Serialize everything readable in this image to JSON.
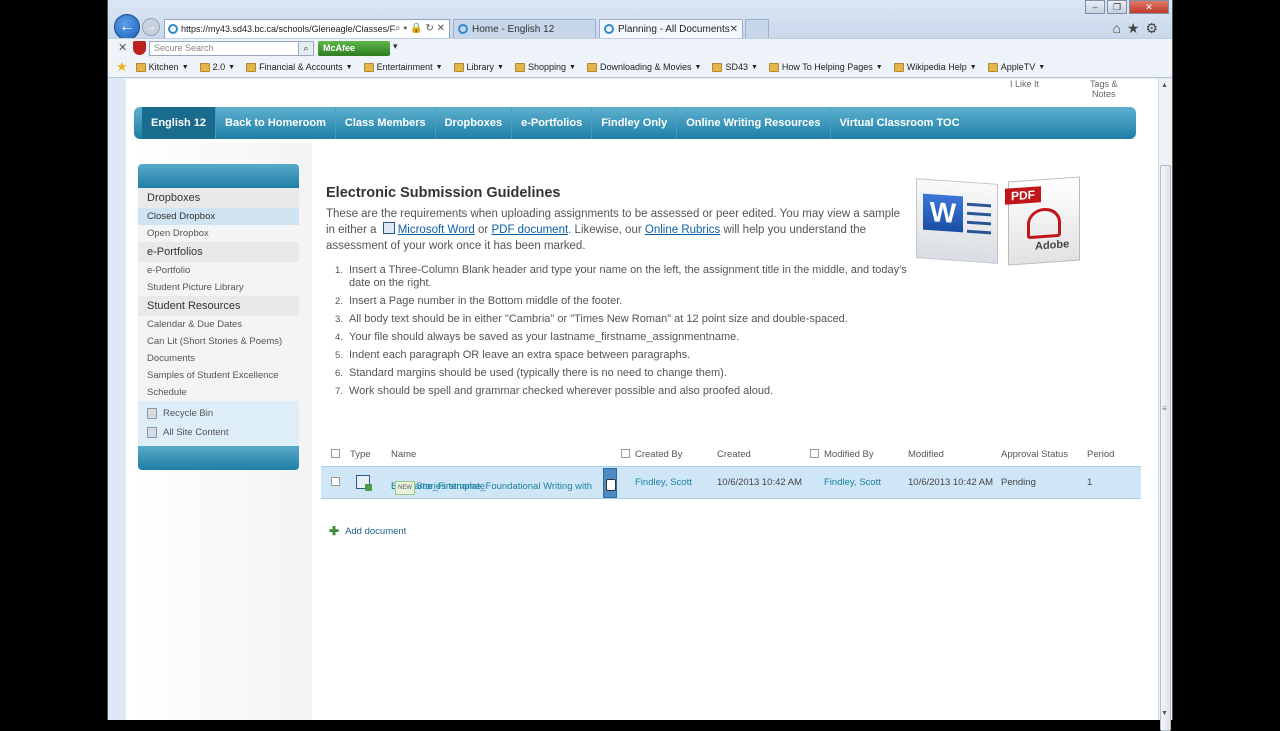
{
  "browser": {
    "address_url": "https://my43.sd43.bc.ca/schools/Gleneagle/Classes/F",
    "tabs": [
      {
        "label": "Home - English 12"
      },
      {
        "label": "Planning - All Documents"
      }
    ],
    "search_placeholder": "Secure Search",
    "mcafee_label": "McAfee"
  },
  "favorites": [
    {
      "label": "Kitchen"
    },
    {
      "label": "2.0"
    },
    {
      "label": "Financial & Accounts"
    },
    {
      "label": "Entertainment"
    },
    {
      "label": "Library"
    },
    {
      "label": "Shopping"
    },
    {
      "label": "Downloading & Movies"
    },
    {
      "label": "SD43"
    },
    {
      "label": "How To Helping Pages"
    },
    {
      "label": "Wikipedia Help"
    },
    {
      "label": "AppleTV"
    }
  ],
  "top_links": {
    "i_like_it": "I Like It",
    "tags_line1": "Tags &",
    "tags_line2": "Notes"
  },
  "topnav": [
    {
      "label": "English 12"
    },
    {
      "label": "Back to Homeroom"
    },
    {
      "label": "Class Members"
    },
    {
      "label": "Dropboxes"
    },
    {
      "label": "e-Portfolios"
    },
    {
      "label": "Findley Only"
    },
    {
      "label": "Online Writing Resources"
    },
    {
      "label": "Virtual Classroom TOC"
    }
  ],
  "sidenav": {
    "sections": [
      {
        "title": "Dropboxes",
        "items": [
          "Closed Dropbox",
          "Open Dropbox"
        ]
      },
      {
        "title": "e-Portfolios",
        "items": [
          "e-Portfolio",
          "Student Picture Library"
        ]
      },
      {
        "title": "Student Resources",
        "items": [
          "Calendar & Due Dates",
          "Can Lit (Short Stories & Poems)",
          "Documents",
          "Samples of Student Excellence",
          "Schedule"
        ]
      }
    ],
    "recycle_bin": "Recycle Bin",
    "all_site_content": "All Site Content"
  },
  "main": {
    "heading": "Electronic Submission Guidelines",
    "intro_part1": "These are the requirements when uploading assignments to be assessed or peer edited. You may view a sample in either a",
    "link_word": "Microsoft Word",
    "or_text": "or",
    "link_pdf": "PDF document",
    "likewise_text": ". Likewise, our",
    "link_rubrics": "Online Rubrics",
    "intro_part2": "will help you understand the assessment of your work once it has been marked.",
    "requirements": [
      "Insert a Three-Column Blank header and type your name on the left, the assignment title in the middle, and today's date on the right.",
      "Insert a Page number in the Bottom middle of the footer.",
      "All body text should be in either \"Cambria\" or \"Times New Roman\" at 12 point size and double-spaced.",
      "Your file should always be saved as your lastname_firstname_assignmentname.",
      "Indent each paragraph OR leave an extra space between paragraphs.",
      "Standard margins should be used (typically there is no need to change them).",
      "Work should be spell and grammar checked wherever possible and also proofed aloud."
    ],
    "logos": {
      "word_letter": "W",
      "pdf_tag": "PDF",
      "adobe_label": "Adobe"
    }
  },
  "list": {
    "columns": {
      "type": "Type",
      "name": "Name",
      "created_by": "Created By",
      "created": "Created",
      "modified_by": "Modified By",
      "modified": "Modified",
      "approval": "Approval Status",
      "period": "Period"
    },
    "rows": [
      {
        "name_line1": "Lastname_Firstname_Foundational Writing with",
        "name_line2": "Short Stories template",
        "new_tag": "NEW",
        "created_by": "Findley, Scott",
        "created": "10/6/2013 10:42 AM",
        "modified_by": "Findley, Scott",
        "modified": "10/6/2013 10:42 AM",
        "approval": "Pending",
        "period": "1"
      }
    ],
    "add_document": "Add document"
  }
}
